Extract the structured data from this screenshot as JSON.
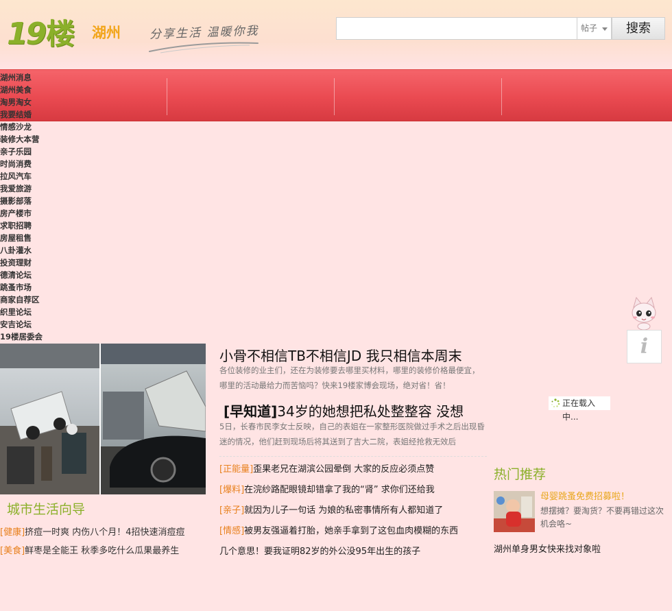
{
  "header": {
    "logo_num": "19",
    "logo_char": "楼",
    "city": "湖州",
    "slogan": "分享生活 温暖你我",
    "search": {
      "placeholder": "",
      "type_label": "帖子",
      "button_label": "搜索"
    }
  },
  "nav": {
    "items": [
      "湖州消息",
      "湖州美食",
      "淘男淘女",
      "我要结婚",
      "情感沙龙",
      "装修大本营",
      "亲子乐园",
      "时尚消费",
      "拉风汽车",
      "我爱旅游",
      "摄影部落",
      "房产楼市",
      "求职招聘",
      "房屋租售",
      "八卦灌水",
      "投资理财",
      "德清论坛",
      "跳蚤市场",
      "商家自荐区",
      "织里论坛",
      "安吉论坛",
      "19楼居委会"
    ]
  },
  "guide": {
    "title": "城市生活向导",
    "items": [
      {
        "tag": "[健康]",
        "text": "挤痘一时爽 内伤八个月！4招快速消痘痘"
      },
      {
        "tag": "[美食]",
        "text": "鲜枣是全能王 秋季多吃什么瓜果最养生"
      }
    ]
  },
  "main": {
    "headline1": "小骨不相信TB不相信JD 我只相信本周末",
    "summary1": "各位装修的业主们，还在为装修要去哪里买材料，哪里的装修价格最便宜，哪里的活动最给力而苦恼吗？快来19楼家博会现场，绝对省！省！",
    "headline2_tag": "[早知道]",
    "headline2": "34岁的她想把私处整整容 没想",
    "summary2": "5日，长春市民李女士反映，自己的表姐在一家整形医院做过手术之后出现昏迷的情况，他们赶到现场后将其送到了吉大二院，表姐经抢救无效后",
    "news": [
      {
        "tag": "[正能量]",
        "text": "歪果老兄在湖滨公园晕倒 大家的反应必须点赞"
      },
      {
        "tag": "[爆料]",
        "text": "在浣纱路配眼镜却错拿了我的“肾” 求你们还给我"
      },
      {
        "tag": "[亲子]",
        "text": "就因为儿子一句话 为娘的私密事情所有人都知道了"
      },
      {
        "tag": "[情感]",
        "text": "被男友强逼着打胎，她亲手拿到了这包血肉模糊的东西"
      },
      {
        "tag": "",
        "text": "几个意思！要我证明82岁的外公没95年出生的孩子"
      }
    ]
  },
  "right": {
    "loading": "正在载入中...",
    "hot_title": "热门推荐",
    "hot_headline": "母婴跳蚤免费招募啦！",
    "hot_desc": "想摆摊？要淘货？不要再错过这次机会咯~",
    "hot_link": "湖州单身男女快来找对象啦",
    "info_label": "i"
  },
  "colors": {
    "background": "#ffe4e4",
    "nav_red": "#ea4a51",
    "logo_green": "#8bb02a",
    "city_orange": "#f2a51a",
    "tag_orange": "#e8811e"
  }
}
